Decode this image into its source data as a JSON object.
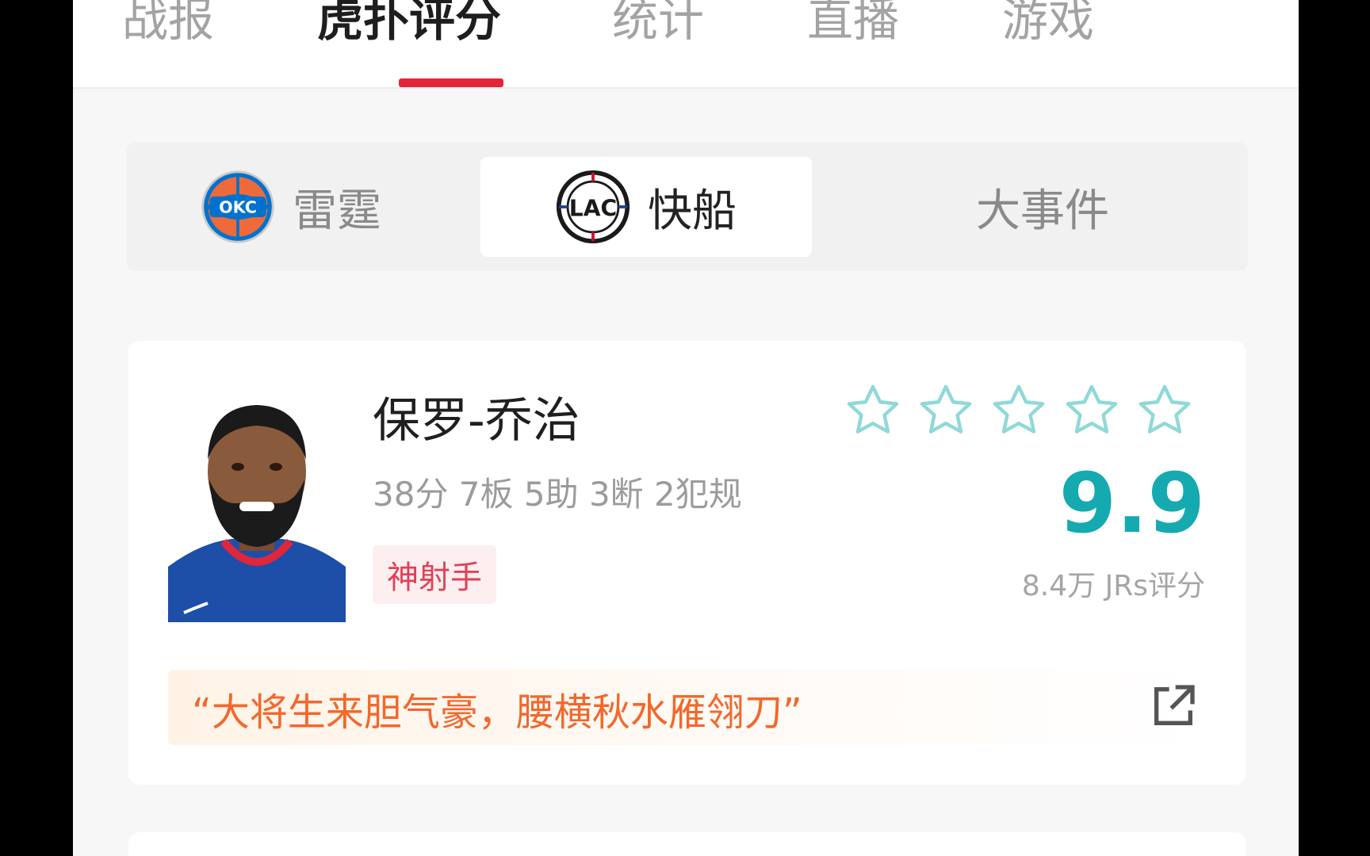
{
  "tabs": [
    {
      "label": "战报",
      "active": false
    },
    {
      "label": "虎扑评分",
      "active": true
    },
    {
      "label": "统计",
      "active": false
    },
    {
      "label": "直播",
      "active": false
    },
    {
      "label": "游戏",
      "active": false
    }
  ],
  "team_switch": {
    "home": {
      "label": "雷霆",
      "logo_text": "OKC"
    },
    "away": {
      "label": "快船",
      "logo_text": "LAC"
    },
    "events": {
      "label": "大事件"
    }
  },
  "player": {
    "name": "保罗-乔治",
    "stats": "38分 7板 5助 3断 2犯规",
    "tag": "神射手",
    "score": "9.9",
    "votes": "8.4万 JRs评分",
    "stars_filled": 0,
    "stars_total": 5,
    "quote": "“大将生来胆气豪，腰横秋水雁翎刀”"
  },
  "colors": {
    "accent_red": "#e5243a",
    "score_teal": "#14aab0",
    "quote_orange": "#f2682d",
    "star_outline": "#8fd9d7"
  },
  "icons": {
    "star": "star-outline-icon",
    "share": "share-external-icon"
  }
}
